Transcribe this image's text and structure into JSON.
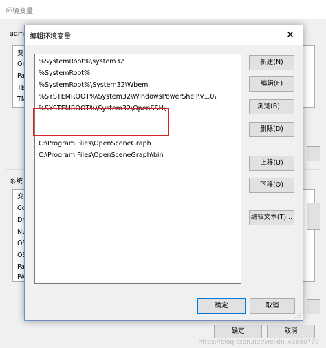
{
  "back_window": {
    "title": "环境变量",
    "user_section_label": "adm",
    "user_list": {
      "header": "变",
      "rows": [
        "On",
        "Pa",
        "TE",
        "TM"
      ]
    },
    "system_section_label": "系统",
    "system_list": {
      "header": "变",
      "rows": [
        "Co",
        "Dr",
        "NU",
        "OS",
        "OS",
        "Pa",
        "PA"
      ]
    },
    "ok_label": "确定",
    "cancel_label": "取消"
  },
  "dialog": {
    "title": "编辑环境变量",
    "close_glyph": "✕",
    "entries": [
      "%SystemRoot%\\system32",
      "%SystemRoot%",
      "%SystemRoot%\\System32\\Wbem",
      "%SYSTEMROOT%\\System32\\WindowsPowerShell\\v1.0\\",
      "%SYSTEMROOT%\\System32\\OpenSSH\\",
      "C:\\Program Files\\OpenSceneGraph",
      "C:\\Program Files\\OpenSceneGraph\\bin"
    ],
    "buttons": {
      "new": "新建(N)",
      "edit": "编辑(E)",
      "browse": "浏览(B)...",
      "delete": "删除(D)",
      "move_up": "上移(U)",
      "move_down": "下移(O)",
      "edit_text": "编辑文本(T)...",
      "ok": "确定",
      "cancel": "取消"
    }
  },
  "watermark": "https://blog.csdn.net/weixin_43860779",
  "colors": {
    "highlight_border": "#d8222a",
    "dialog_border": "#6f8fbf",
    "focus_border": "#0078d7"
  }
}
